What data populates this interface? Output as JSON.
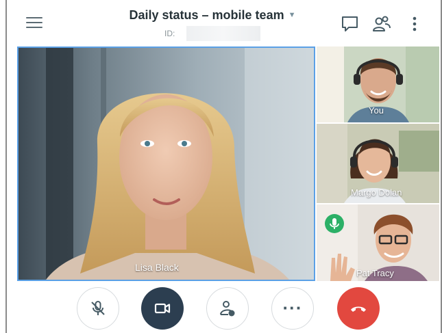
{
  "header": {
    "title": "Daily status – mobile team",
    "meeting_id_label": "ID:",
    "icons": [
      "menu-icon",
      "chevron-down-icon",
      "chat-icon",
      "participants-icon",
      "more-vertical-icon"
    ]
  },
  "participants": {
    "main": {
      "name": "Lisa Black"
    },
    "thumbnails": [
      {
        "name": "You"
      },
      {
        "name": "Margo Dolan"
      },
      {
        "name": "Pat Tracy",
        "speaking": true
      }
    ]
  },
  "controls": {
    "buttons": [
      "mute-mic",
      "camera",
      "share-content",
      "more-options",
      "end-call"
    ]
  },
  "colors": {
    "active_border": "#5aa0e6",
    "end_call": "#e2483f",
    "camera_button": "#2c3e50",
    "mic_active": "#2cb067",
    "title_text": "#263238"
  }
}
